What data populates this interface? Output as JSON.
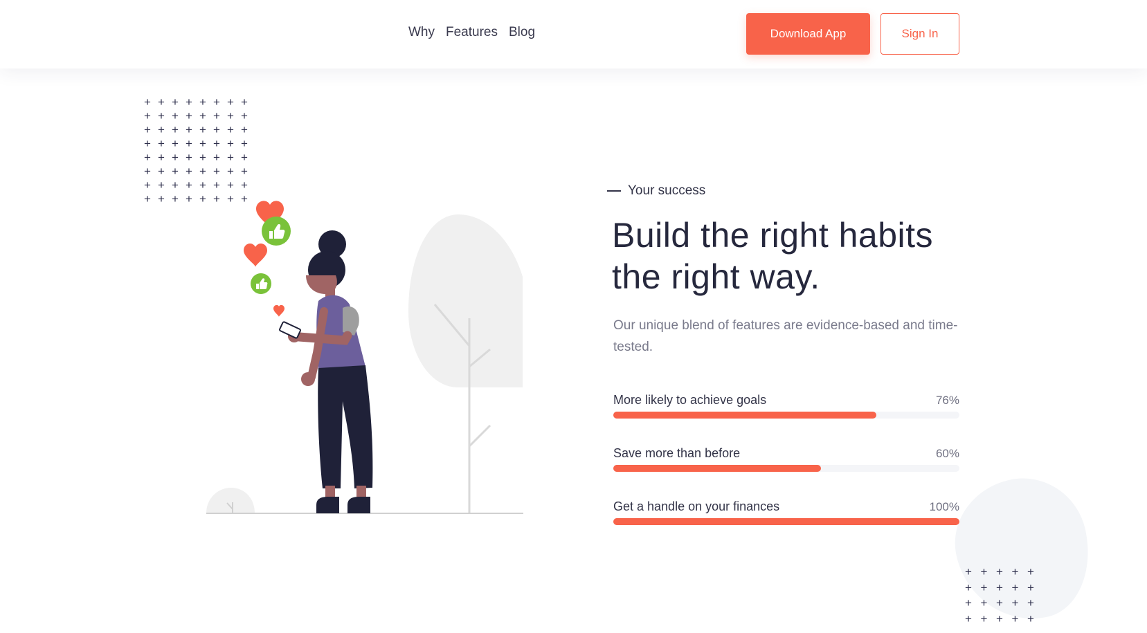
{
  "header": {
    "nav": [
      {
        "label": "Why"
      },
      {
        "label": "Features"
      },
      {
        "label": "Blog"
      }
    ],
    "download_label": "Download App",
    "signin_label": "Sign In"
  },
  "hero": {
    "eyebrow": "Your success",
    "headline_line1": "Build the right habits",
    "headline_line2": "the right way.",
    "description": "Our unique blend of features are evidence-based and time-tested.",
    "progress": [
      {
        "label": "More likely to achieve goals",
        "value_text": "76%",
        "value": 76
      },
      {
        "label": "Save more than before",
        "value_text": "60%",
        "value": 60
      },
      {
        "label": "Get a handle on your finances",
        "value_text": "100%",
        "value": 100
      }
    ]
  },
  "colors": {
    "accent": "#f8634a",
    "like_green": "#7ac23a",
    "figure_purple": "#6c5f9c",
    "text_dark": "#26283d"
  },
  "illustration": {
    "icons": [
      "heart-icon",
      "thumbs-up-icon",
      "heart-icon",
      "thumbs-up-icon",
      "heart-icon"
    ]
  }
}
